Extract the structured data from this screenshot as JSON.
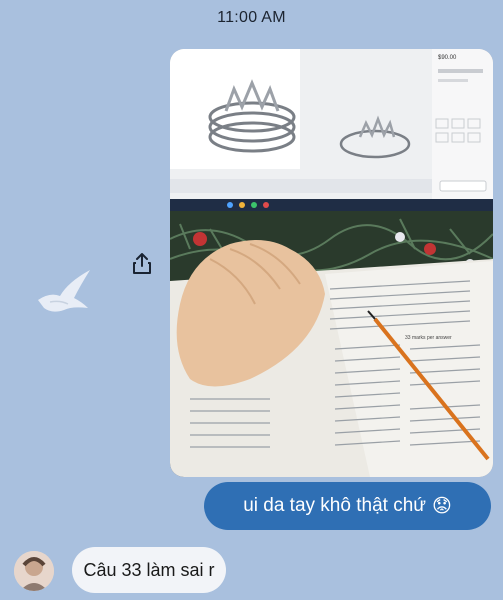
{
  "status_bar": {
    "time": "11:00 AM"
  },
  "photo_message": {
    "icon": "image-attachment",
    "screen_price": "$90.00",
    "worksheet_heading": "33 marks per answer"
  },
  "share_button": {
    "icon": "share-icon"
  },
  "outgoing_message": {
    "text": "ui da tay khô thật chứ",
    "emoji": "😟"
  },
  "incoming_message": {
    "text": "Câu 33 làm sai r"
  },
  "colors": {
    "background": "#a9c0de",
    "outgoing_bubble": "#2f6fb4",
    "incoming_bubble": "#f2f4f8"
  }
}
